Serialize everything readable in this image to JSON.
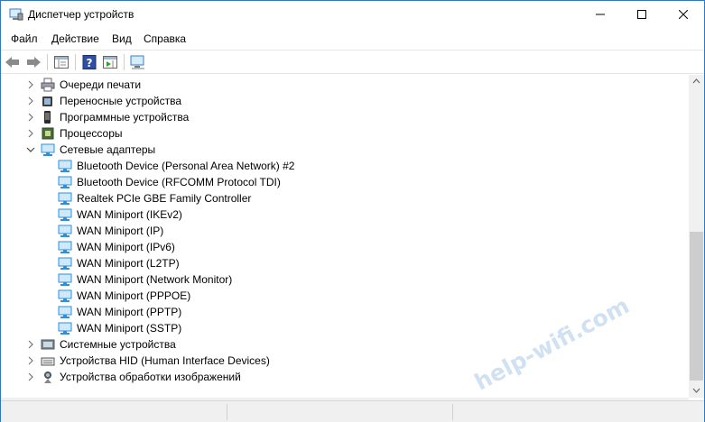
{
  "window": {
    "title": "Диспетчер устройств"
  },
  "menu": [
    "Файл",
    "Действие",
    "Вид",
    "Справка"
  ],
  "toolbar": {
    "buttons": [
      "back-icon",
      "forward-icon",
      "show-hide-console-tree-icon",
      "help-icon",
      "action-pane-icon",
      "scan-hardware-icon"
    ]
  },
  "tree": {
    "items": [
      {
        "label": "Очереди печати",
        "expanded": false,
        "icon": "print-queue-icon"
      },
      {
        "label": "Переносные устройства",
        "expanded": false,
        "icon": "portable-device-icon"
      },
      {
        "label": "Программные устройства",
        "expanded": false,
        "icon": "software-device-icon"
      },
      {
        "label": "Процессоры",
        "expanded": false,
        "icon": "processor-icon"
      },
      {
        "label": "Сетевые адаптеры",
        "expanded": true,
        "icon": "network-adapter-icon"
      }
    ],
    "network_adapters": [
      "Bluetooth Device (Personal Area Network) #2",
      "Bluetooth Device (RFCOMM Protocol TDI)",
      "Realtek PCIe GBE Family Controller",
      "WAN Miniport (IKEv2)",
      "WAN Miniport (IP)",
      "WAN Miniport (IPv6)",
      "WAN Miniport (L2TP)",
      "WAN Miniport (Network Monitor)",
      "WAN Miniport (PPPOE)",
      "WAN Miniport (PPTP)",
      "WAN Miniport (SSTP)"
    ],
    "after": [
      {
        "label": "Системные устройства",
        "expanded": false,
        "icon": "system-device-icon"
      },
      {
        "label": "Устройства HID (Human Interface Devices)",
        "expanded": false,
        "icon": "hid-icon"
      },
      {
        "label": "Устройства обработки изображений",
        "expanded": false,
        "icon": "imaging-device-icon"
      }
    ]
  },
  "watermark": "help-wifi.com",
  "colors": {
    "window_border": "#2b79c8",
    "network_icon": "#2f8fd8",
    "scroll_thumb": "#cdcdcd"
  }
}
